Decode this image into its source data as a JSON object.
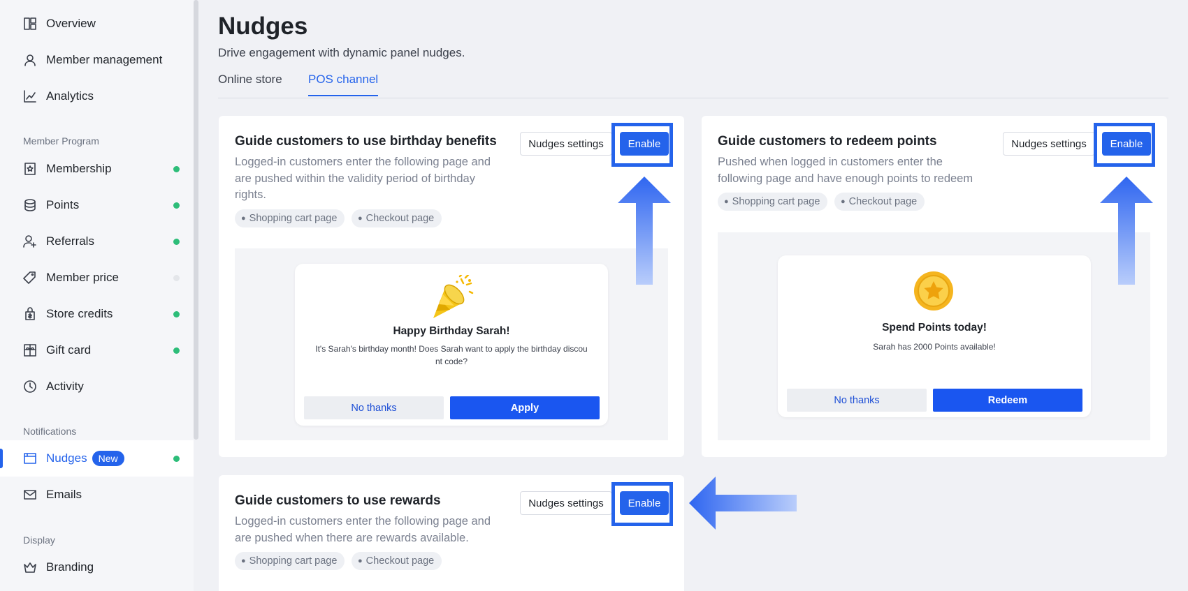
{
  "sidebar": {
    "items": [
      {
        "label": "Overview",
        "icon": "layout-icon"
      },
      {
        "label": "Member management",
        "icon": "user-icon"
      },
      {
        "label": "Analytics",
        "icon": "chart-icon"
      }
    ],
    "member_program_label": "Member Program",
    "member_program": [
      {
        "label": "Membership",
        "icon": "membership-icon",
        "status": "enabled"
      },
      {
        "label": "Points",
        "icon": "coins-icon",
        "status": "enabled"
      },
      {
        "label": "Referrals",
        "icon": "user-plus-icon",
        "status": "enabled"
      },
      {
        "label": "Member price",
        "icon": "tag-icon",
        "status": "disabled"
      },
      {
        "label": "Store credits",
        "icon": "store-credit-icon",
        "status": "enabled"
      },
      {
        "label": "Gift card",
        "icon": "gift-card-icon",
        "status": "enabled"
      },
      {
        "label": "Activity",
        "icon": "clock-icon"
      }
    ],
    "notifications_label": "Notifications",
    "notifications": [
      {
        "label": "Nudges",
        "badge": "New",
        "icon": "nudges-icon",
        "status": "enabled",
        "active": true
      },
      {
        "label": "Emails",
        "icon": "mail-icon"
      }
    ],
    "display_label": "Display",
    "display": [
      {
        "label": "Branding",
        "icon": "crown-icon"
      }
    ]
  },
  "header": {
    "title": "Nudges",
    "subtitle": "Drive engagement with dynamic panel nudges."
  },
  "tabs": [
    {
      "label": "Online store",
      "active": false
    },
    {
      "label": "POS channel",
      "active": true
    }
  ],
  "cards": {
    "birthday": {
      "title": "Guide customers to use birthday benefits",
      "desc_lines": [
        "Logged-in customers enter the following page and",
        "are pushed within the validity period of birthday",
        "rights."
      ],
      "chips": [
        "Shopping cart page",
        "Checkout page"
      ],
      "settings_label": "Nudges settings",
      "enable_label": "Enable",
      "preview": {
        "title": "Happy Birthday Sarah!",
        "text_lines": [
          "It's Sarah's birthday month! Does Sarah want to apply the birthday discou",
          "nt code?"
        ],
        "no_label": "No thanks",
        "yes_label": "Apply"
      }
    },
    "points": {
      "title": "Guide customers to redeem points",
      "desc_lines": [
        "Pushed when logged in customers enter the",
        "following page and have enough points to redeem"
      ],
      "chips": [
        "Shopping cart page",
        "Checkout page"
      ],
      "settings_label": "Nudges settings",
      "enable_label": "Enable",
      "preview": {
        "title": "Spend Points today!",
        "text": "Sarah has 2000 Points available!",
        "no_label": "No thanks",
        "yes_label": "Redeem"
      }
    },
    "rewards": {
      "title": "Guide customers to use rewards",
      "desc_lines": [
        "Logged-in customers enter the following page and",
        "are pushed when there are rewards available."
      ],
      "chips": [
        "Shopping cart page",
        "Checkout page"
      ],
      "settings_label": "Nudges settings",
      "enable_label": "Enable"
    }
  },
  "colors": {
    "accent": "#2463eb",
    "status_on": "#2dbd79",
    "status_off": "#e4e6ea"
  }
}
